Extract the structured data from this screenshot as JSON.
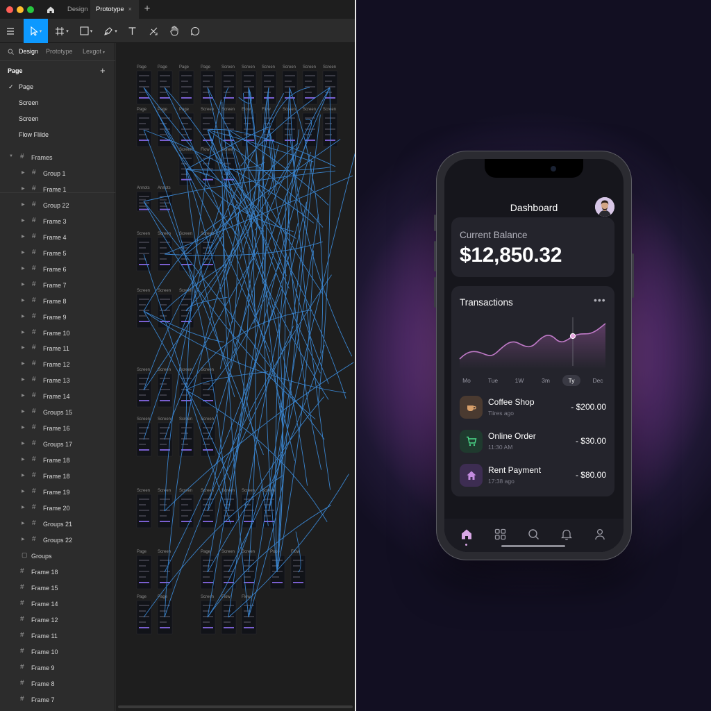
{
  "editor": {
    "tabs": [
      {
        "label": "Design"
      },
      {
        "label": "Prototype",
        "close": "×"
      }
    ],
    "new_tab": "+",
    "toolbar_icons": [
      "menu-icon",
      "move-icon",
      "frame-icon",
      "shape-icon",
      "pen-icon",
      "text-icon",
      "resources-icon",
      "hand-icon",
      "comment-icon"
    ],
    "accent": "#0d99ff",
    "sidebar": {
      "tabs": [
        "Design",
        "Prototype",
        "Lexgot"
      ],
      "pages_header": "Page",
      "add_page": "+",
      "pages": [
        "Page",
        "Screen",
        "Screen",
        "Flow Flilde"
      ],
      "selected_page": "Page",
      "layers_header": "Frames",
      "layers": [
        "Group 1",
        "Frame 1",
        "Group 22",
        "Frame 3",
        "Frame 4",
        "Frame 5",
        "Frame 6",
        "Frame 7",
        "Frame 8",
        "Frame 9",
        "Frame 10",
        "Frame 11",
        "Frame 12",
        "Frame 13",
        "Frame 14",
        "Groups 15",
        "Frame 16",
        "Groups 17",
        "Frame 18",
        "Frame 18",
        "Frame 19",
        "Frame 20",
        "Groups 21",
        "Groups 22"
      ],
      "flat_layers": [
        "Groups",
        "Frame 18",
        "Frame 15",
        "Frame 14",
        "Frame 12",
        "Frame 11",
        "Frame 10",
        "Frame 9",
        "Frame 8",
        "Frame 7"
      ]
    },
    "canvas": {
      "frame_labels": {
        "row1": [
          "Page",
          "Page",
          "Page",
          "Page",
          "Screen",
          "Screen",
          "Screen",
          "Screen",
          "Screen",
          "Screen"
        ],
        "row2": [
          "Page",
          "Page",
          "Page",
          "Screen",
          "Screen",
          "Elow",
          "Flow",
          "Screen",
          "Screen",
          "Screen"
        ],
        "row3": [
          "Screen",
          "Flow",
          "Screen"
        ],
        "row4": [
          "Annots",
          "Annots"
        ],
        "row5": [
          "Screen",
          "Screen",
          "Screen",
          "Screen"
        ],
        "row6": [
          "Screen",
          "Screen",
          "Screen"
        ],
        "row7": [
          "Screen",
          "Screen",
          "Screen",
          "Screen"
        ],
        "row8": [
          "Screen",
          "Screen",
          "Screen",
          "Screen"
        ],
        "row9": [
          "Screen",
          "Screen",
          "Screen",
          "Screen",
          "Screen",
          "Screen",
          "Screen"
        ],
        "row10": [
          "Page",
          "Screen",
          "Page",
          "Screen",
          "Screen",
          "Poco",
          "Flow"
        ],
        "row11": [
          "Page",
          "Page",
          "Screen",
          "Flow",
          "Flow"
        ]
      },
      "wire_color": "#3d8fe0"
    }
  },
  "phone": {
    "title": "Dashboard",
    "balance_label": "Current Balance",
    "balance_value": "$12,850.32",
    "transactions_title": "Transactions",
    "more": "•••",
    "ranges": [
      "Mo",
      "Tue",
      "1W",
      "3m",
      "Ty",
      "Dec"
    ],
    "selected_range": "Ty",
    "chart_line_color": "#c07ac8",
    "transactions": [
      {
        "name": "Coffee Shop",
        "time": "Tiires ago",
        "amount": "- $200.00",
        "icon": "coffee-icon",
        "icon_bg": "#4a3a30",
        "icon_color": "#d9a06a"
      },
      {
        "name": "Online Order",
        "time": "11:30 AM",
        "amount": "- $30.00",
        "icon": "cart-icon",
        "icon_bg": "#1f3a2e",
        "icon_color": "#4ddc8c"
      },
      {
        "name": "Rent Payment",
        "time": "17:38 ago",
        "amount": "- $80.00",
        "icon": "home-icon",
        "icon_bg": "#3d2d52",
        "icon_color": "#c38be0"
      }
    ],
    "nav": [
      "home-icon",
      "grid-icon",
      "search-icon",
      "bell-icon",
      "profile-icon"
    ],
    "active_nav": "home-icon",
    "accent": "#d9a7e6"
  }
}
